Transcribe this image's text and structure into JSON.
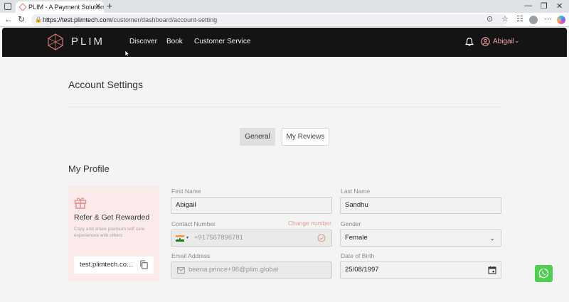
{
  "browser": {
    "tab_title": "PLIM - A Payment Solution For Th",
    "tab_close": "✕",
    "new_tab": "+",
    "window_controls": [
      "—",
      "❐",
      "✕"
    ],
    "nav": {
      "back": "←",
      "refresh": "↻"
    },
    "url_host": "https://test.plimtech.com",
    "url_path": "/customer/dashboard/account-setting",
    "lock_glyph": "🔒"
  },
  "header": {
    "brand": "PLIM",
    "nav": [
      "Discover",
      "Book",
      "Customer Service"
    ],
    "user_name": "Abigail",
    "user_chevron": "⌄"
  },
  "page": {
    "title": "Account Settings",
    "tabs": [
      {
        "label": "General",
        "active": true
      },
      {
        "label": "My Reviews",
        "active": false
      }
    ],
    "section_title": "My Profile"
  },
  "refer": {
    "title": "Refer & Get Rewarded",
    "description": "Copy and share premium self care experiences with others",
    "link": "test.plimtech.com/refer"
  },
  "form": {
    "first_name": {
      "label": "First Name",
      "value": "Abigail"
    },
    "last_name": {
      "label": "Last Name",
      "value": "Sandhu"
    },
    "contact": {
      "label": "Contact Number",
      "value": "+917567896781",
      "action": "Change number",
      "caret": "▾"
    },
    "gender": {
      "label": "Gender",
      "value": "Female",
      "chevron": "⌄"
    },
    "email": {
      "label": "Email Address",
      "value": "beena.prince+98@plim.global"
    },
    "dob": {
      "label": "Date of Birth",
      "value": "25/08/1997"
    }
  },
  "colors": {
    "header_bg": "#141414",
    "accent_pink": "#f1a7a7",
    "refer_card_bg": "#fbeaea",
    "whatsapp_green": "#4fcf50"
  },
  "icons": [
    "logo-icon",
    "bell-icon",
    "user-icon",
    "gift-icon",
    "copy-icon",
    "india-flag-icon",
    "verified-icon",
    "mail-icon",
    "calendar-icon",
    "whatsapp-icon"
  ]
}
